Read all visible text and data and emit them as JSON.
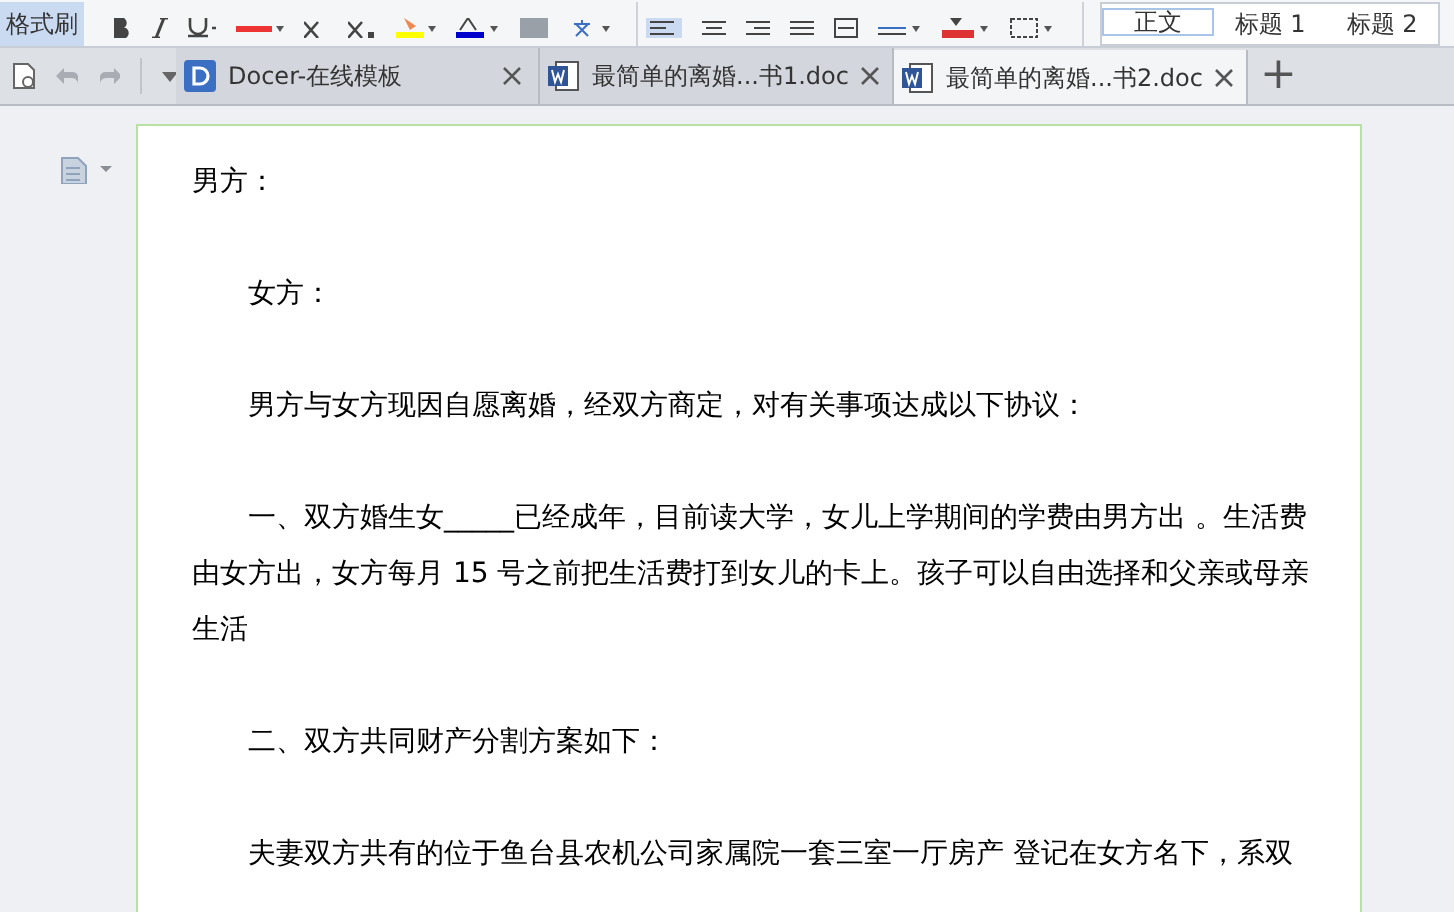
{
  "toolbar": {
    "format_painter": "格式刷",
    "styles": [
      {
        "label": "正文",
        "selected": true
      },
      {
        "label": "标题 1",
        "selected": false
      },
      {
        "label": "标题 2",
        "selected": false
      }
    ]
  },
  "tabs": [
    {
      "kind": "docer",
      "label": "Docer-在线模板",
      "selected": false
    },
    {
      "kind": "doc",
      "label": "最简单的离婚...书1.doc",
      "selected": false
    },
    {
      "kind": "doc",
      "label": "最简单的离婚...书2.doc",
      "selected": true
    }
  ],
  "new_tab": "+",
  "document": {
    "paragraphs": [
      {
        "text": "男方：",
        "indent": false
      },
      {
        "text": "女方：",
        "indent": true
      },
      {
        "text": "男方与女方现因自愿离婚，经双方商定，对有关事项达成以下协议：",
        "indent": true
      },
      {
        "text": "一、双方婚生女_____已经成年，目前读大学，女儿上学期间的学费由男方出 。生活费由女方出，女方每月 15 号之前把生活费打到女儿的卡上。孩子可以自由选择和父亲或母亲生活",
        "indent": true
      },
      {
        "text": "二、双方共同财产分割方案如下：",
        "indent": true
      },
      {
        "text": "夫妻双方共有的位于鱼台县农机公司家属院一套三室一厅房产 登记在女方名下，系双",
        "indent": true
      }
    ]
  }
}
